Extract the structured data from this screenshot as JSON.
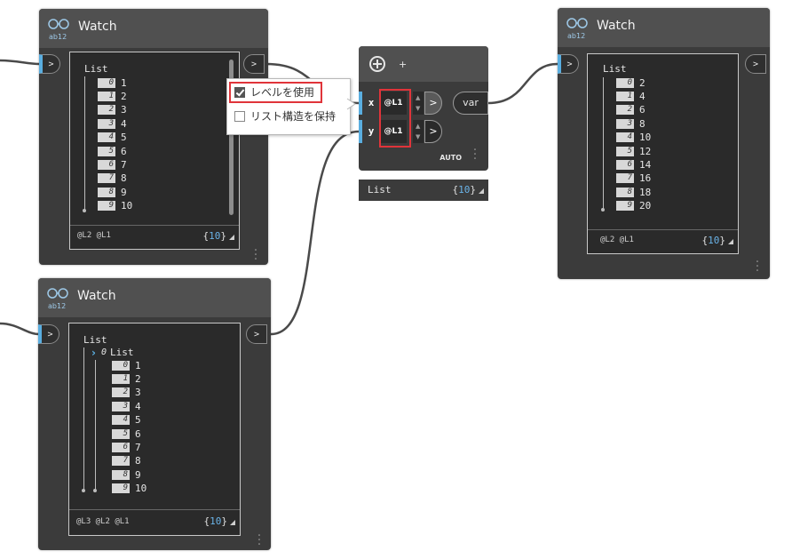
{
  "watch_nodes": [
    {
      "title": "Watch",
      "list_label": "List",
      "items": [
        {
          "i": "0",
          "v": "1"
        },
        {
          "i": "1",
          "v": "2"
        },
        {
          "i": "2",
          "v": "3"
        },
        {
          "i": "3",
          "v": "4"
        },
        {
          "i": "4",
          "v": "5"
        },
        {
          "i": "5",
          "v": "6"
        },
        {
          "i": "6",
          "v": "7"
        },
        {
          "i": "7",
          "v": "8"
        },
        {
          "i": "8",
          "v": "9"
        },
        {
          "i": "9",
          "v": "10"
        }
      ],
      "levels": "@L2 @L1",
      "count": "10",
      "in_port": ">",
      "out_port": ">"
    },
    {
      "title": "Watch",
      "list_label": "List",
      "sublist_index": "0",
      "sublist_label": "List",
      "items": [
        {
          "i": "0",
          "v": "1"
        },
        {
          "i": "1",
          "v": "2"
        },
        {
          "i": "2",
          "v": "3"
        },
        {
          "i": "3",
          "v": "4"
        },
        {
          "i": "4",
          "v": "5"
        },
        {
          "i": "5",
          "v": "6"
        },
        {
          "i": "6",
          "v": "7"
        },
        {
          "i": "7",
          "v": "8"
        },
        {
          "i": "8",
          "v": "9"
        },
        {
          "i": "9",
          "v": "10"
        }
      ],
      "levels": "@L3 @L2 @L1",
      "count": "10",
      "in_port": ">",
      "out_port": ">"
    },
    {
      "title": "Watch",
      "list_label": "List",
      "items": [
        {
          "i": "0",
          "v": "2"
        },
        {
          "i": "1",
          "v": "4"
        },
        {
          "i": "2",
          "v": "6"
        },
        {
          "i": "3",
          "v": "8"
        },
        {
          "i": "4",
          "v": "10"
        },
        {
          "i": "5",
          "v": "12"
        },
        {
          "i": "6",
          "v": "14"
        },
        {
          "i": "7",
          "v": "16"
        },
        {
          "i": "8",
          "v": "18"
        },
        {
          "i": "9",
          "v": "20"
        }
      ],
      "levels": "@L2 @L1",
      "count": "10",
      "in_port": ">",
      "out_port": ">"
    }
  ],
  "context_menu": {
    "use_levels": "レベルを使用",
    "keep_list_structure": "リスト構造を保持",
    "use_levels_checked": true,
    "keep_list_structure_checked": false
  },
  "code_block": {
    "add_label": "+",
    "remove_label": "-",
    "inputs": [
      {
        "name": "x",
        "level": "@L1",
        "chevron": ">"
      },
      {
        "name": "y",
        "level": "@L1",
        "chevron": ">"
      }
    ],
    "output": "var",
    "lacing": "AUTO",
    "preview_label": "List",
    "preview_count": "10"
  },
  "colors": {
    "canvas": "#ffffff",
    "node_body": "#3b3b3b",
    "node_header": "#505050",
    "port_accent": "#5aaee0",
    "highlight": "#e0343a",
    "count_number": "#6ab3e8"
  }
}
